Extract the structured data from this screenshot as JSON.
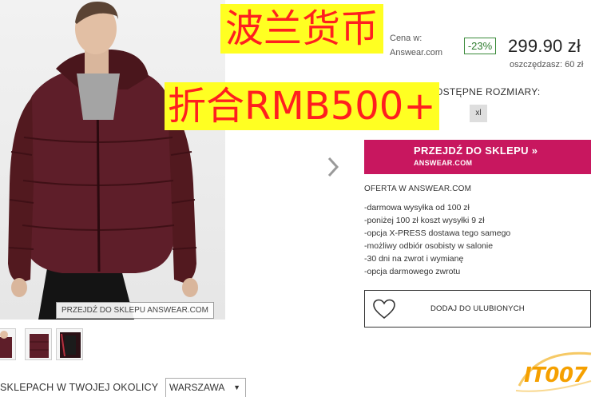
{
  "product": {
    "photo_caption": "PRZEJDŹ DO SKLEPU ANSWEAR.COM",
    "thumbnails": [
      "thumb-front",
      "thumb-back",
      "thumb-detail",
      "thumb-lining"
    ]
  },
  "store": {
    "label": "Cena w:",
    "name": "Answear.com"
  },
  "price": {
    "discount": "-23%",
    "current": "299.90 zł",
    "savings": "oszczędzasz: 60 zł"
  },
  "sizes": {
    "label": "DOSTĘPNE ROZMIARY:",
    "options": [
      "xl"
    ]
  },
  "go_button": {
    "label": "PRZEJDŹ DO SKLEPU »",
    "sublabel": "ANSWEAR.COM",
    "color": "#c8175f"
  },
  "offer": {
    "title": "OFERTA W ANSWEAR.COM",
    "items": [
      "-darmowa wysyłka od 100 zł",
      "-poniżej 100 zł koszt wysyłki 9 zł",
      "-opcja X-PRESS dostawa tego samego",
      "-możliwy odbiór osobisty w salonie",
      "-30 dni na zwrot i wymianę",
      "-opcja darmowego zwrotu"
    ]
  },
  "favorites": {
    "label": "DODAJ DO ULUBIONYCH",
    "icon": "heart-icon"
  },
  "location": {
    "label": "SKLEPACH W TWOJEJ OKOLICY",
    "city": "WARSZAWA"
  },
  "overlay": {
    "line1": "波兰货币",
    "line2": "折合RMB500+",
    "text_color": "#ff1f1f",
    "bg_color": "#ffff22"
  },
  "watermark": {
    "text": "IT007"
  },
  "colors": {
    "accent": "#c8175f",
    "discount": "#2f7d2f"
  }
}
